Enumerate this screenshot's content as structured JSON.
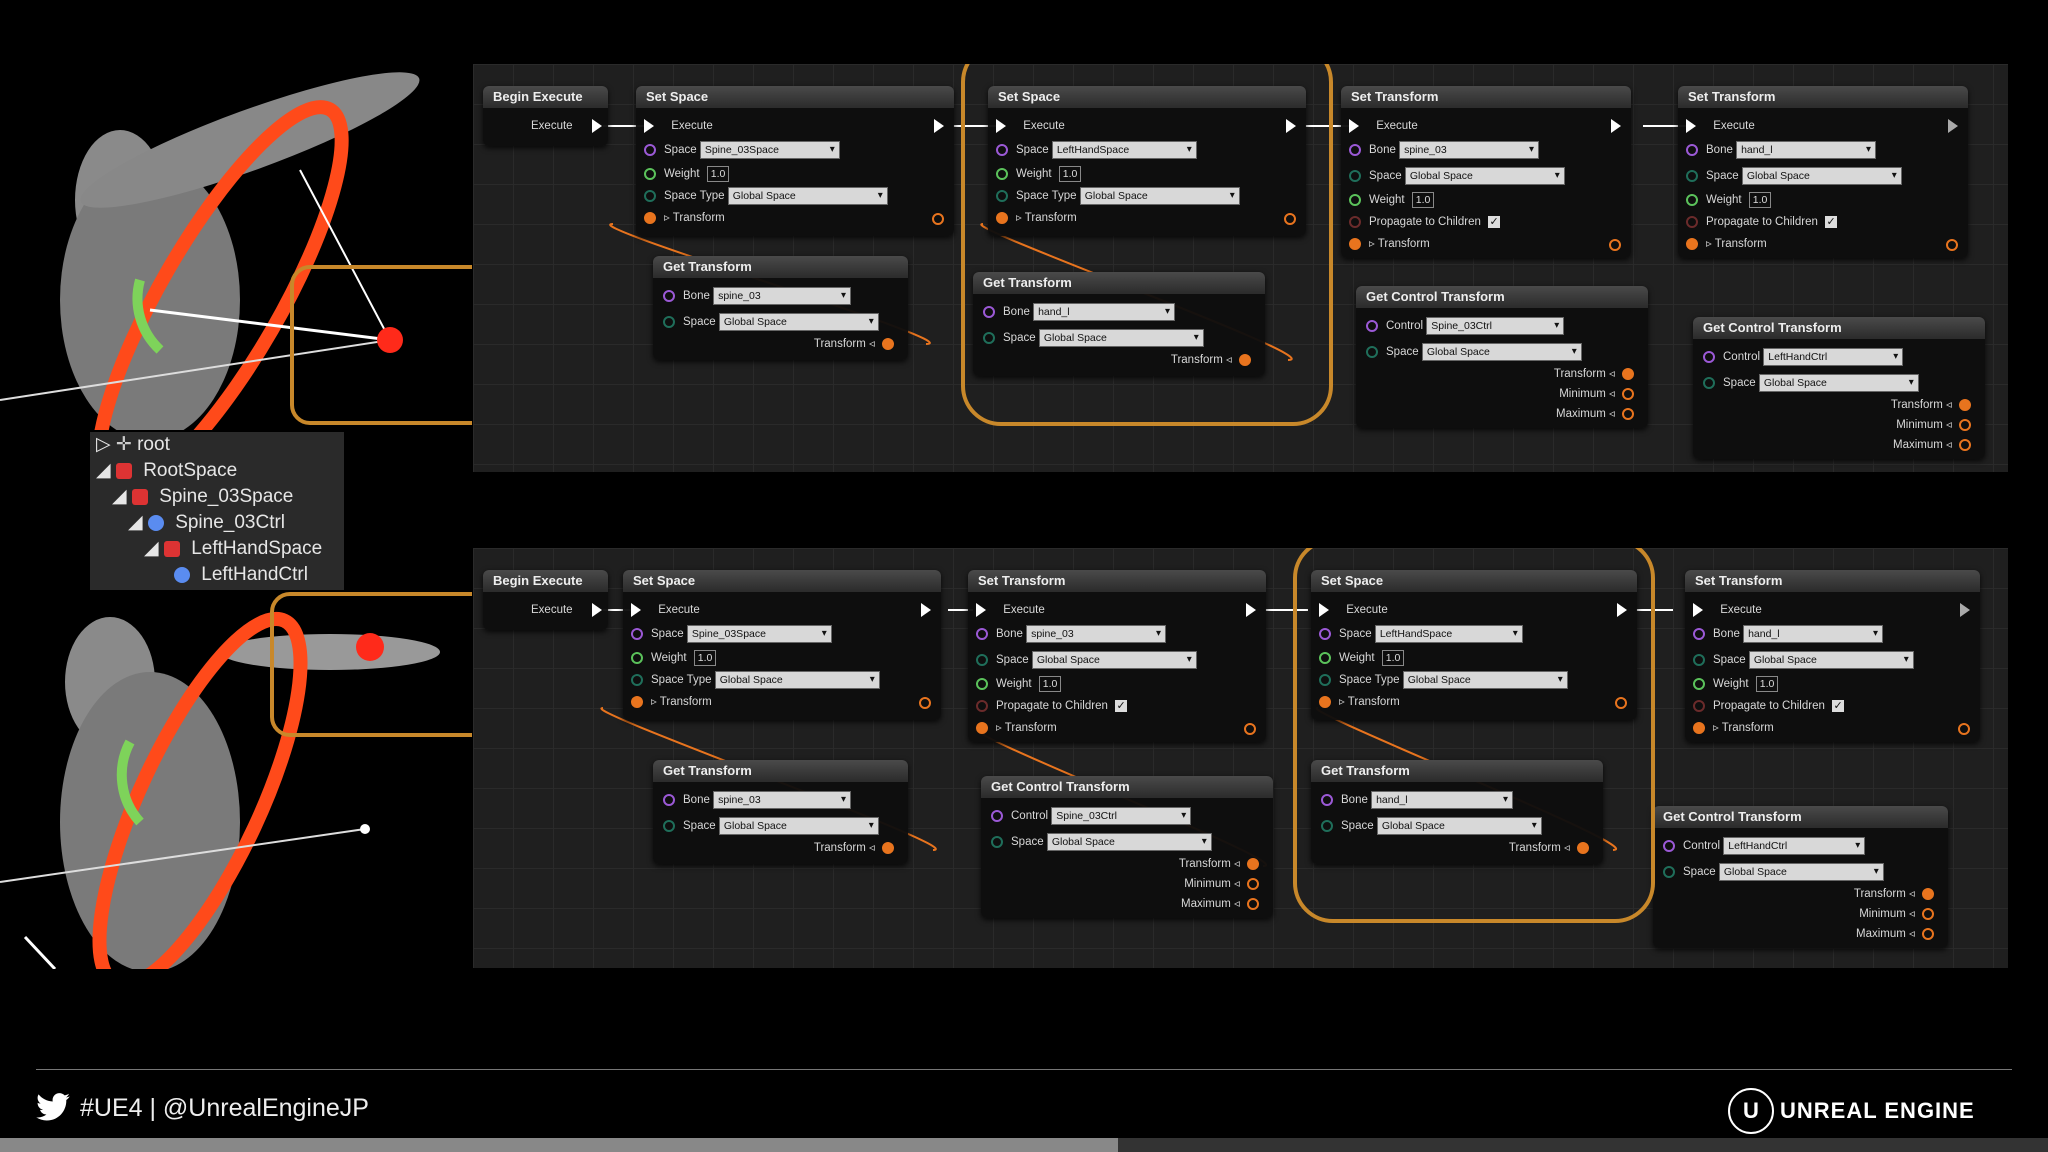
{
  "outliner": {
    "items": [
      "root",
      "RootSpace",
      "Spine_03Space",
      "Spine_03Ctrl",
      "LeftHandSpace",
      "LeftHandCtrl"
    ]
  },
  "labels": {
    "begin_execute": "Begin Execute",
    "set_space": "Set Space",
    "set_transform": "Set Transform",
    "get_transform": "Get Transform",
    "get_control_transform": "Get Control Transform",
    "execute": "Execute",
    "space": "Space",
    "weight": "Weight",
    "space_type": "Space Type",
    "transform": "Transform",
    "bone": "Bone",
    "control": "Control",
    "propagate": "Propagate to Children",
    "minimum": "Minimum",
    "maximum": "Maximum"
  },
  "values": {
    "spine03space": "Spine_03Space",
    "lefthandspace": "LeftHandSpace",
    "global_space": "Global Space",
    "spine_03": "spine_03",
    "hand_l": "hand_l",
    "spine03ctrl": "Spine_03Ctrl",
    "lefthandctrl": "LeftHandCtrl",
    "weight": "1.0",
    "check": "✓"
  },
  "footer": {
    "hashtag": "#UE4 | @UnrealEngineJP",
    "brand": "UNREAL ENGINE"
  },
  "colors": {
    "accent": "#e8741e",
    "highlight": "#c8882a",
    "exec_pin": "#ffffff",
    "space_pin": "#9b59d6",
    "weight_pin": "#5bc25b"
  }
}
